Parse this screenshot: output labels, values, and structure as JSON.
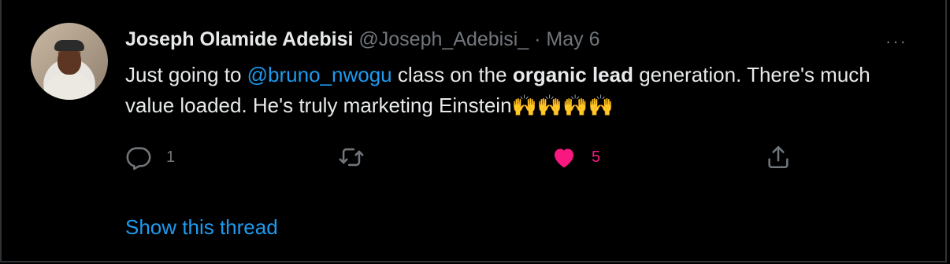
{
  "tweet": {
    "author_name": "Joseph Olamide Adebisi",
    "handle": "@Joseph_Adebisi_",
    "separator": "·",
    "date": "May 6",
    "text_parts": {
      "p1": "Just going to ",
      "mention": "@bruno_nwogu",
      "p2": "  class on the ",
      "bold": "organic lead",
      "p3": " generation. There's much value loaded. He's truly marketing Einstein",
      "emojis": "🙌🙌🙌🙌"
    }
  },
  "actions": {
    "reply_count": "1",
    "retweet_count": "",
    "like_count": "5",
    "like_color": "#f91880"
  },
  "more_label": "···",
  "show_thread_label": "Show this thread",
  "icons": {
    "reply": "reply-icon",
    "retweet": "retweet-icon",
    "like": "heart-icon",
    "share": "share-icon",
    "more": "more-icon"
  }
}
